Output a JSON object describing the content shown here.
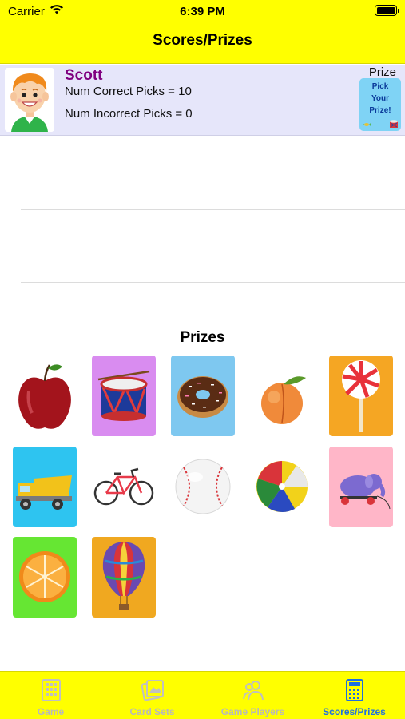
{
  "status_bar": {
    "carrier": "Carrier",
    "time": "6:39 PM"
  },
  "nav": {
    "title": "Scores/Prizes"
  },
  "player": {
    "name": "Scott",
    "correct_text": "Num Correct Picks = 10",
    "incorrect_text": "Num Incorrect Picks = 0",
    "prize_label": "Prize",
    "pick_card_lines": [
      "Pick",
      "Your",
      "Prize!"
    ]
  },
  "prizes_section": {
    "title": "Prizes",
    "items": [
      {
        "name": "apple",
        "bg": "#ffffff"
      },
      {
        "name": "drum",
        "bg": "#d98cf0"
      },
      {
        "name": "donut",
        "bg": "#7ec8f0"
      },
      {
        "name": "peach",
        "bg": "#ffffff"
      },
      {
        "name": "lollipop",
        "bg": "#f5a623"
      },
      {
        "name": "dump-truck",
        "bg": "#2ec4f0"
      },
      {
        "name": "bicycle",
        "bg": "#ffffff"
      },
      {
        "name": "baseball",
        "bg": "#ffffff"
      },
      {
        "name": "beach-ball",
        "bg": "#ffffff"
      },
      {
        "name": "toy-elephant",
        "bg": "#ffb6c8"
      },
      {
        "name": "orange",
        "bg": "#66e633"
      },
      {
        "name": "hot-air-balloon",
        "bg": "#f0a820"
      }
    ]
  },
  "tabs": [
    {
      "label": "Game",
      "icon": "grid-icon",
      "active": false
    },
    {
      "label": "Card Sets",
      "icon": "cards-icon",
      "active": false
    },
    {
      "label": "Game Players",
      "icon": "people-icon",
      "active": false
    },
    {
      "label": "Scores/Prizes",
      "icon": "calculator-icon",
      "active": true
    }
  ],
  "colors": {
    "bar": "#ffff00",
    "player_row": "#e6e6fa",
    "player_name": "#800080",
    "active_tab": "#1e6fe0",
    "inactive_tab": "#b9b9b9"
  }
}
